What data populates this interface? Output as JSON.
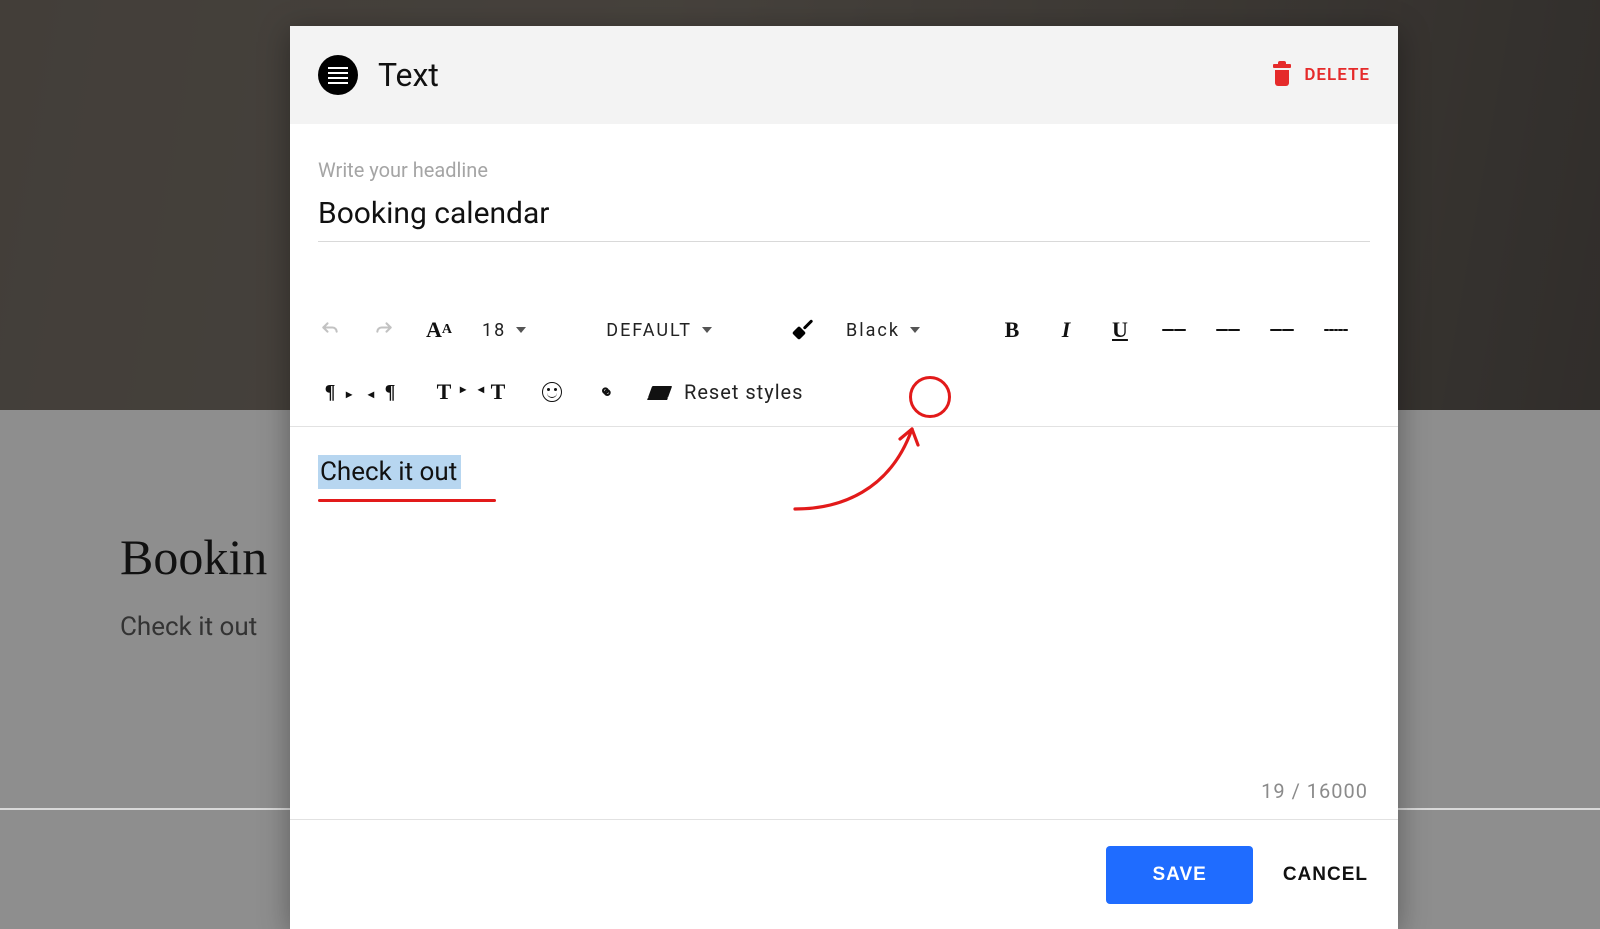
{
  "background": {
    "title": "Bookin",
    "subtitle": "Check it out"
  },
  "modal": {
    "title": "Text",
    "delete_label": "DELETE",
    "headline_placeholder": "Write your headline",
    "headline_value": "Booking calendar",
    "toolbar": {
      "font_size": "18",
      "font_family": "DEFAULT",
      "color_label": "Black",
      "reset_label": "Reset styles"
    },
    "body_text": "Check it out",
    "counter": "19 / 16000",
    "save_label": "SAVE",
    "cancel_label": "CANCEL"
  }
}
